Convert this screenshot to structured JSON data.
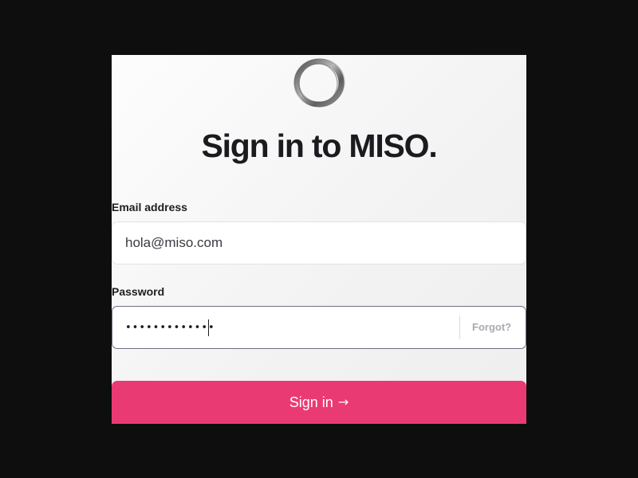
{
  "logo": {
    "icon": "miso-ring-logo"
  },
  "title": "Sign in to MISO.",
  "email": {
    "label": "Email address",
    "value": "hola@miso.com"
  },
  "password": {
    "label": "Password",
    "value": "•••••••••••••",
    "forgot_label": "Forgot?"
  },
  "sign_in": {
    "label": "Sign in",
    "icon": "arrow-right-icon",
    "arrow": "→",
    "color": "#ea3a74"
  },
  "colors": {
    "background": "#0e0e0e",
    "card": "#f5f5f5",
    "accent": "#ea3a74"
  }
}
